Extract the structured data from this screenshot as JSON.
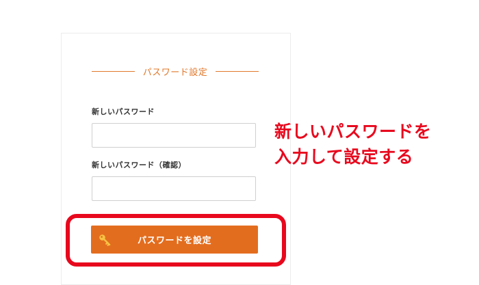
{
  "form": {
    "section_title": "パスワード設定",
    "new_password_label": "新しいパスワード",
    "new_password_value": "",
    "confirm_password_label": "新しいパスワード（確認）",
    "confirm_password_value": "",
    "submit_label": "パスワードを設定",
    "submit_icon": "key-icon"
  },
  "annotation": {
    "line1": "新しいパスワードを",
    "line2": "入力して設定する"
  },
  "colors": {
    "accent": "#e0782b",
    "button": "#e36d1e",
    "annotation_red": "#e8081d"
  }
}
